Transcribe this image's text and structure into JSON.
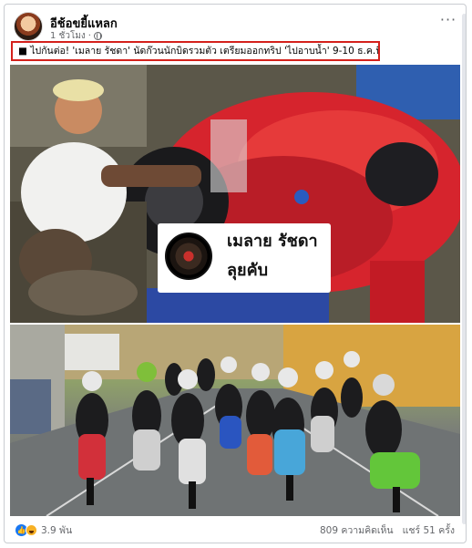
{
  "post": {
    "page_name": "อีช้อขยี้แหลก",
    "time": "1 ชั่วโมง",
    "caption": "■ ไปกันต่อ! 'เมลาย รัชดา' นัดก๊วนนักบิดรวมตัว เตรียมออกทริป 'ไปอาบน้ำ' 9-10 ธ.ค.นี้..."
  },
  "image1": {
    "label_line1": "เมลาย รัชดา",
    "label_line2": "ลุยคับ"
  },
  "footer": {
    "reaction_count": "3.9 พัน",
    "comments": "809 ความคิดเห็น",
    "shares": "แชร์ 51 ครั้ง"
  },
  "icons": {
    "more": "more-options-icon",
    "globe": "globe-icon",
    "like": "like-reaction-icon",
    "haha": "haha-reaction-icon"
  },
  "colors": {
    "highlight_border": "#d4211c",
    "like_blue": "#1877f2",
    "muted_text": "#65676b"
  }
}
